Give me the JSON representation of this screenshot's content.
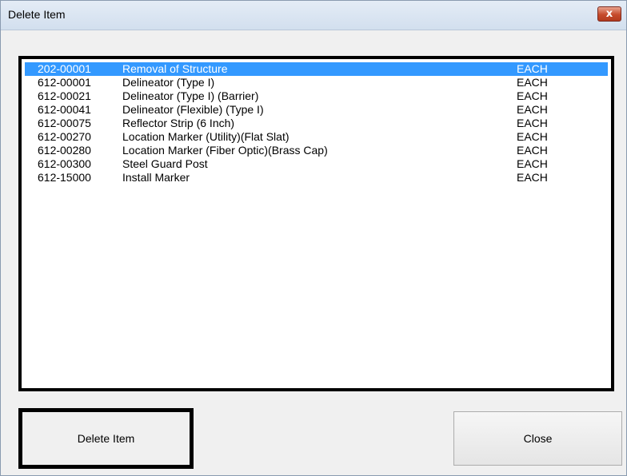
{
  "window": {
    "title": "Delete Item",
    "close_glyph": "x"
  },
  "list": {
    "selected_index": 0,
    "items": [
      {
        "code": "202-00001",
        "description": "Removal of Structure",
        "unit": "EACH"
      },
      {
        "code": "612-00001",
        "description": "Delineator (Type I)",
        "unit": "EACH"
      },
      {
        "code": "612-00021",
        "description": "Delineator (Type I) (Barrier)",
        "unit": "EACH"
      },
      {
        "code": "612-00041",
        "description": "Delineator (Flexible) (Type I)",
        "unit": "EACH"
      },
      {
        "code": "612-00075",
        "description": "Reflector Strip (6 Inch)",
        "unit": "EACH"
      },
      {
        "code": "612-00270",
        "description": "Location Marker (Utility)(Flat Slat)",
        "unit": "EACH"
      },
      {
        "code": "612-00280",
        "description": "Location Marker (Fiber Optic)(Brass Cap)",
        "unit": "EACH"
      },
      {
        "code": "612-00300",
        "description": "Steel Guard Post",
        "unit": "EACH"
      },
      {
        "code": "612-15000",
        "description": "Install Marker",
        "unit": "EACH"
      }
    ]
  },
  "buttons": {
    "delete_label": "Delete Item",
    "close_label": "Close"
  },
  "colors": {
    "selection": "#3399ff",
    "title_bar": "#dbe5f1",
    "close_button": "#c64b2b"
  }
}
